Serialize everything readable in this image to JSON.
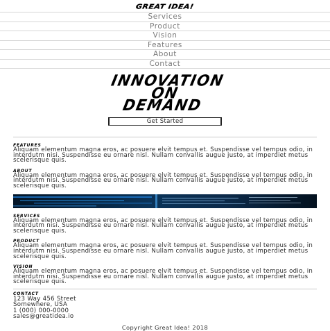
{
  "brand": {
    "logo_text": "GREAT IDEA!"
  },
  "nav": {
    "items": [
      {
        "label": "Services"
      },
      {
        "label": "Product"
      },
      {
        "label": "Vision"
      },
      {
        "label": "Features"
      },
      {
        "label": "About"
      },
      {
        "label": "Contact"
      }
    ]
  },
  "hero": {
    "title": "INNOVATION\nON\nDEMAND",
    "cta_label": "Get Started"
  },
  "sections": {
    "features": {
      "label": "FEATURES",
      "text": "Aliquam elementum magna eros, ac posuere elvit tempus et. Suspendisse vel tempus odio, in interdutm nisi. Suspendisse eu ornare nisl. Nullam convallis augue justo, at imperdiet metus scelerisque quis."
    },
    "about": {
      "label": "ABOUT",
      "text": "Aliquam elementum magna eros, ac posuere elvit tempus et. Suspendisse vel tempus odio, in interdutm nisi. Suspendisse eu ornare nisl. Nullam convallis augue justo, at imperdiet metus scelerisque quis."
    },
    "services": {
      "label": "SERVICES",
      "text": "Aliquam elementum magna eros, ac posuere elvit tempus et. Suspendisse vel tempus odio, in interdutm nisi. Suspendisse eu ornare nisl. Nullam convallis augue justo, at imperdiet metus scelerisque quis."
    },
    "product": {
      "label": "PRODUCT",
      "text": "Aliquam elementum magna eros, ac posuere elvit tempus et. Suspendisse vel tempus odio, in interdutm nisi. Suspendisse eu ornare nisl. Nullam convallis augue justo, at imperdiet metus scelerisque quis."
    },
    "vision": {
      "label": "VISION",
      "text": "Aliquam elementum magna eros, ac posuere elvit tempus et. Suspendisse vel tempus odio, in interdutm nisi. Suspendisse eu ornare nisl. Nullam convallis augue justo, at imperdiet metus scelerisque quis."
    }
  },
  "contact": {
    "label": "CONTACT",
    "address1": "123 Way 456 Street",
    "address2": "Somewhere, USA",
    "phone": "1 (000) 000-0000",
    "email": "sales@greatidea.io"
  },
  "footer": {
    "copyright": "Copyright Great Idea! 2018"
  },
  "colors": {
    "banner_bg": "#06203a",
    "banner_accent": "#1f7bd1",
    "nav_text": "#7a7a7a",
    "divider": "#d6d6d6"
  }
}
